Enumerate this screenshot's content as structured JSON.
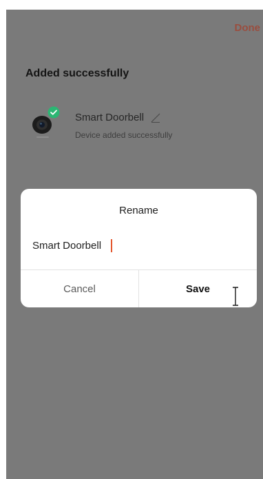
{
  "header": {
    "done_label": "Done"
  },
  "page": {
    "heading": "Added successfully"
  },
  "device": {
    "name": "Smart Doorbell",
    "status": "Device added successfully",
    "image_icon": "doorbell-camera",
    "badge_icon": "check-badge",
    "edit_icon": "pencil-edit"
  },
  "dialog": {
    "title": "Rename",
    "input_value": "Smart Doorbell",
    "cancel_label": "Cancel",
    "save_label": "Save"
  },
  "colors": {
    "overlay_background": "#7a7a7a",
    "done_text": "#9a4d3e",
    "badge": "#2bb673",
    "caret": "#e4572e",
    "dialog_background": "#ffffff"
  },
  "cursor": {
    "type": "text-ibeam"
  }
}
